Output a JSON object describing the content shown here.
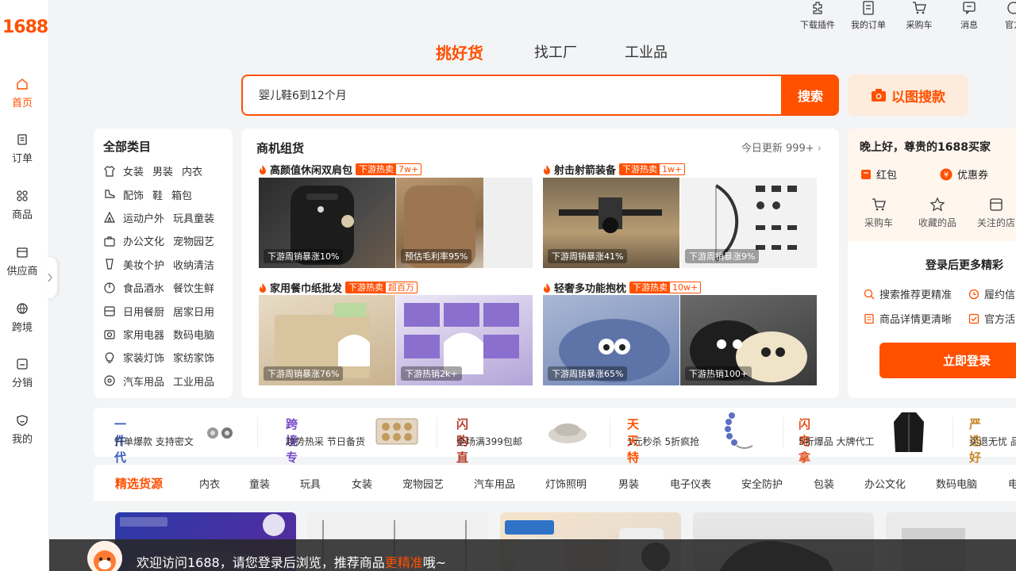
{
  "brand": {
    "logo": "1688"
  },
  "sidebar": {
    "items": [
      {
        "label": "首页",
        "icon": "home-icon",
        "active": true
      },
      {
        "label": "订单",
        "icon": "order-icon"
      },
      {
        "label": "商品",
        "icon": "grid-icon"
      },
      {
        "label": "供应商",
        "icon": "supplier-icon"
      },
      {
        "label": "跨境",
        "icon": "globe-icon"
      },
      {
        "label": "分销",
        "icon": "share-icon"
      },
      {
        "label": "我的",
        "icon": "user-icon"
      }
    ]
  },
  "toolbar": {
    "items": [
      {
        "label": "下载插件",
        "icon": "plugin-icon"
      },
      {
        "label": "我的订单",
        "icon": "order-icon"
      },
      {
        "label": "采购车",
        "icon": "cart-icon"
      },
      {
        "label": "消息",
        "icon": "message-icon"
      },
      {
        "label": "官方",
        "icon": "official-icon"
      }
    ]
  },
  "tabs": [
    {
      "label": "挑好货",
      "active": true
    },
    {
      "label": "找工厂"
    },
    {
      "label": "工业品"
    }
  ],
  "search": {
    "value": "婴儿鞋6到12个月",
    "button": "搜索",
    "image_search": "以图搜款"
  },
  "categories": {
    "title": "全部类目",
    "rows": [
      {
        "icon": "shirt-icon",
        "items": [
          "女装",
          "男装",
          "内衣"
        ]
      },
      {
        "icon": "shoe-icon",
        "items": [
          "配饰",
          "鞋",
          "箱包"
        ]
      },
      {
        "icon": "tent-icon",
        "items": [
          "运动户外",
          "玩具童装"
        ]
      },
      {
        "icon": "briefcase-icon",
        "items": [
          "办公文化",
          "宠物园艺"
        ]
      },
      {
        "icon": "cosmetics-icon",
        "items": [
          "美妆个护",
          "收纳清洁"
        ]
      },
      {
        "icon": "food-icon",
        "items": [
          "食品酒水",
          "餐饮生鲜"
        ]
      },
      {
        "icon": "daily-icon",
        "items": [
          "日用餐厨",
          "居家日用"
        ]
      },
      {
        "icon": "camera-icon",
        "items": [
          "家用电器",
          "数码电脑"
        ]
      },
      {
        "icon": "bulb-icon",
        "items": [
          "家装灯饰",
          "家纺家饰"
        ]
      },
      {
        "icon": "car-icon",
        "items": [
          "汽车用品",
          "工业用品"
        ]
      }
    ]
  },
  "business": {
    "title": "商机组货",
    "update": "今日更新 999+",
    "groups": [
      {
        "title": "高颜值休闲双肩包",
        "badge_a": "下游热卖",
        "badge_b": "7w+",
        "tiles": [
          "下游周销暴涨10%",
          "预估毛利率95%"
        ]
      },
      {
        "title": "射击射箭装备",
        "badge_a": "下游热卖",
        "badge_b": "1w+",
        "tiles": [
          "下游周销暴涨41%",
          "下游周销暴涨9%"
        ]
      },
      {
        "title": "家用餐巾纸批发",
        "badge_a": "下游热卖",
        "badge_b": "超百万",
        "tiles": [
          "下游周销暴涨76%",
          "下游热销2k+"
        ]
      },
      {
        "title": "轻奢多功能抱枕",
        "badge_a": "下游热卖",
        "badge_b": "10w+",
        "tiles": [
          "下游周销暴涨65%",
          "下游热销100+"
        ]
      }
    ]
  },
  "user": {
    "greeting": "晚上好，尊贵的1688买家",
    "red_packet": "红包",
    "coupon": "优惠券",
    "quick": [
      {
        "label": "采购车",
        "icon": "cart-icon"
      },
      {
        "label": "收藏的品",
        "icon": "star-icon"
      },
      {
        "label": "关注的店",
        "icon": "shop-icon"
      }
    ],
    "login_more": "登录后更多精彩",
    "features": [
      "搜索推荐更精准",
      "履约信",
      "商品详情更清晰",
      "官方活"
    ],
    "login_button": "立即登录"
  },
  "promos": [
    {
      "title": "一件代发",
      "sub": "开单爆款 支持密文",
      "color": "#3a5bbf"
    },
    {
      "title": "跨境专供",
      "sub": "趋势热采 节日备货",
      "color": "#7a4bc9"
    },
    {
      "title": "闪购直供",
      "sub": "全场满399包邮",
      "color": "#b33a2a"
    },
    {
      "title": "天天特卖",
      "sub": "1元秒杀 5折疯抢",
      "color": "#ff5000"
    },
    {
      "title": "闪电拿样",
      "sub": "5折爆品 大牌代工",
      "color": "#e0501e"
    },
    {
      "title": "严选好物",
      "sub": "买退无忧 品",
      "color": "#c8862a"
    }
  ],
  "select_tabs": {
    "items": [
      "精选货源",
      "内衣",
      "童装",
      "玩具",
      "女装",
      "宠物园艺",
      "汽车用品",
      "灯饰照明",
      "男装",
      "电子仪表",
      "安全防护",
      "包装",
      "办公文化",
      "数码电脑",
      "电"
    ]
  },
  "banner": {
    "text_a": "欢迎访问1688，请您登录后浏览，推荐商品",
    "text_hl": "更精准",
    "text_b": "哦~"
  },
  "colors": {
    "accent": "#ff5000"
  }
}
